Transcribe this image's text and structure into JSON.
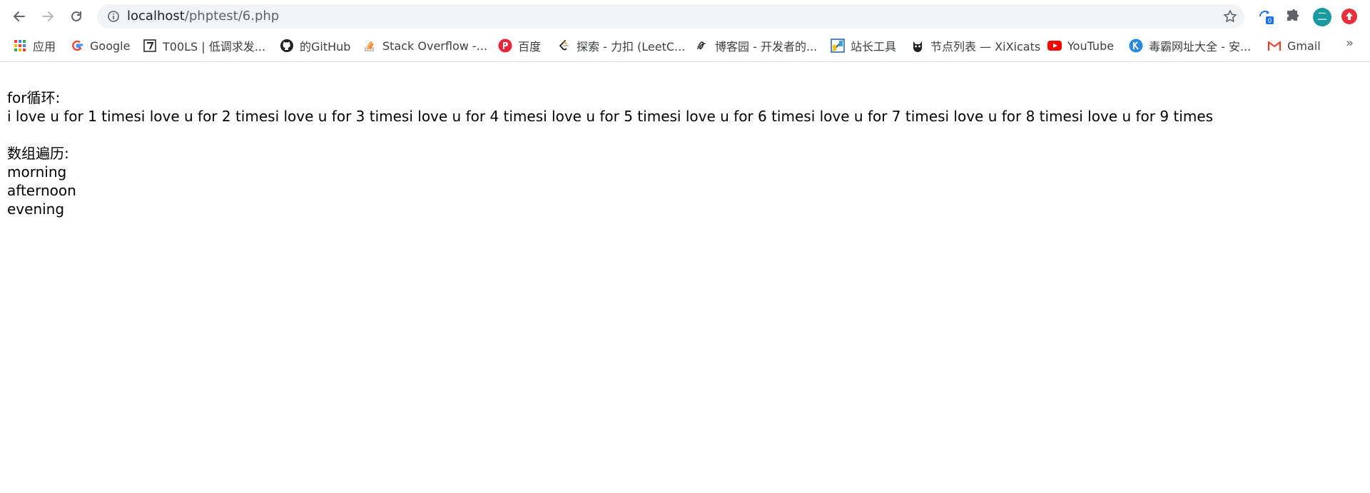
{
  "browser": {
    "url_host": "localhost",
    "url_path": "/phptest/6.php",
    "icons": {
      "back": "back-arrow-icon",
      "forward": "forward-arrow-icon",
      "reload": "reload-icon",
      "info": "info-icon",
      "star": "star-icon",
      "sync": "sync-extension-icon",
      "puzzle": "extensions-puzzle-icon"
    },
    "sync_badge": "0",
    "profile_initial": "二",
    "colors": {
      "profile": "#1a9aa0",
      "red_ext": "#e8303a",
      "badge": "#1a73e8"
    }
  },
  "bookmarks": [
    {
      "label": "应用",
      "icon": "apps-grid-icon"
    },
    {
      "label": "Google",
      "icon": "google-icon"
    },
    {
      "label": "T00LS | 低调求发...",
      "icon": "tools-icon"
    },
    {
      "label": "的GitHub",
      "icon": "github-icon"
    },
    {
      "label": "Stack Overflow -...",
      "icon": "stackoverflow-icon"
    },
    {
      "label": "百度",
      "icon": "baidu-icon"
    },
    {
      "label": "探索 - 力扣 (LeetC...",
      "icon": "leetcode-icon"
    },
    {
      "label": "博客园 - 开发者的...",
      "icon": "cnblogs-icon"
    },
    {
      "label": "站长工具",
      "icon": "chinaz-icon"
    },
    {
      "label": "节点列表 — XiXicats",
      "icon": "xixicats-icon"
    },
    {
      "label": "YouTube",
      "icon": "youtube-icon"
    },
    {
      "label": "毒霸网址大全 - 安...",
      "icon": "duba-icon"
    },
    {
      "label": "Gmail",
      "icon": "gmail-icon"
    }
  ],
  "bookmarks_more": "»",
  "page": {
    "for_heading": "for循环:",
    "for_output": "i love u for 1 timesi love u for 2 timesi love u for 3 timesi love u for 4 timesi love u for 5 timesi love u for 6 timesi love u for 7 timesi love u for 8 timesi love u for 9 times",
    "array_heading": "数组遍历:",
    "array_items": [
      "morning",
      "afternoon",
      "evening"
    ]
  }
}
